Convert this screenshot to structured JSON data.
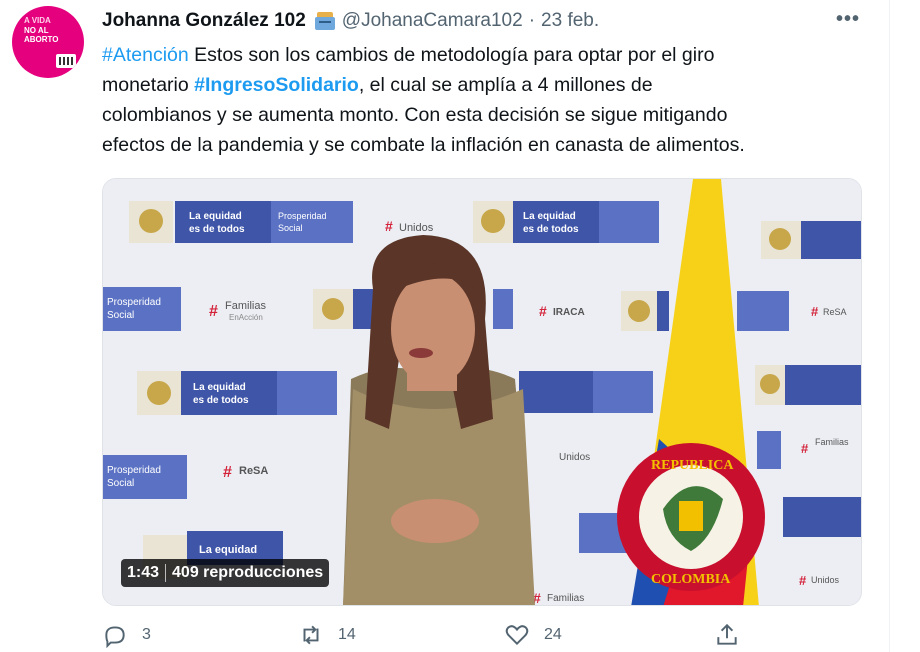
{
  "author": {
    "display_name": "Johanna González 102",
    "handle": "@JohanaCamara102",
    "separator": "·",
    "date": "23 feb.",
    "avatar_colors": {
      "background": "#e5007e"
    }
  },
  "tweet": {
    "hashtag_1": "#Atención",
    "line_1_rest": " Estos son los cambios de metodología para optar por el giro",
    "line_2_start": "monetario  ",
    "hashtag_2": "#IngresoSolidario",
    "line_2_rest": ", el cual se amplía a 4 millones de",
    "line_3": "colombianos y se aumenta monto. Con esta decisión se sigue mitigando",
    "line_4": "efectos de la pandemia y se combate la inflación en canasta de alimentos."
  },
  "media": {
    "duration": "1:43",
    "views": "409 reproducciones",
    "backdrop_texts": {
      "equidad_1": "La equidad",
      "equidad_2": "es de todos",
      "prosperidad_1": "Prosperidad",
      "prosperidad_2": "Social",
      "unidos": "Unidos",
      "familias_1": "Familias",
      "familias_2": "EnAcción",
      "iraca": "IRACA",
      "resa": "ReSA"
    }
  },
  "actions": {
    "replies": "3",
    "retweets": "14",
    "likes": "24"
  },
  "colors": {
    "accent": "#1d9bf0",
    "secondary_text": "#536471",
    "text": "#0f1419"
  },
  "icons": {
    "more": "more-icon",
    "reply": "reply-icon",
    "retweet": "retweet-icon",
    "like": "heart-icon",
    "share": "share-icon"
  }
}
